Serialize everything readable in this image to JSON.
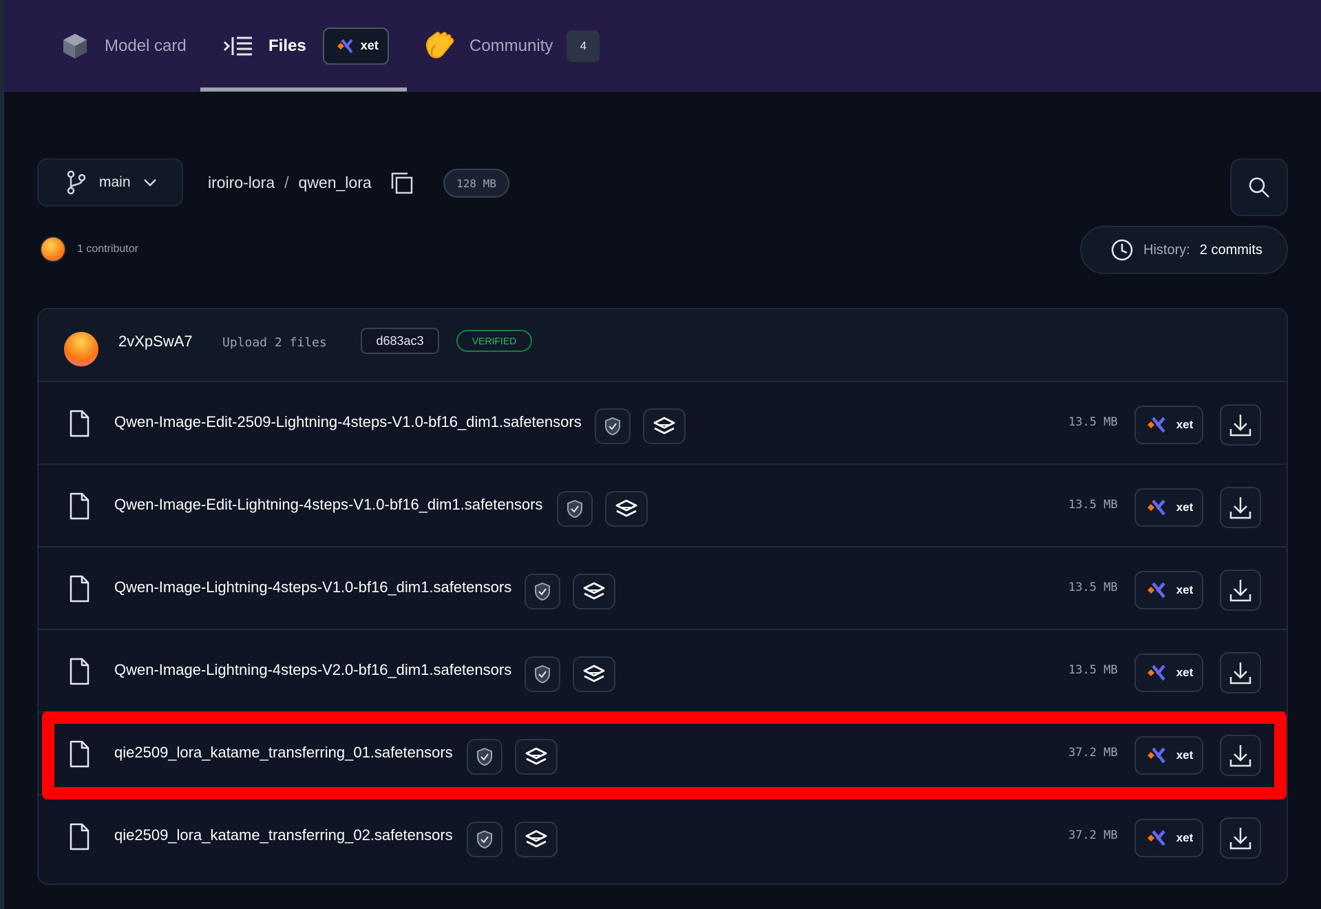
{
  "nav": {
    "tabs": [
      {
        "label": "Model card",
        "icon": "cube-icon"
      },
      {
        "label": "Files",
        "icon": "file-tree-icon",
        "badge": "xet"
      },
      {
        "label": "Community",
        "icon": "clapping-hands-icon",
        "count": "4"
      }
    ]
  },
  "repo": {
    "branch": "main",
    "owner": "iroiro-lora",
    "name": "qwen_lora",
    "size": "128 MB",
    "contributors": "1 contributor",
    "history_label": "History:",
    "history_value": "2 commits"
  },
  "commit": {
    "author": "2vXpSwA7",
    "message": "Upload 2 files",
    "sha": "d683ac3",
    "status": "VERIFIED"
  },
  "files": [
    {
      "name": "Qwen-Image-Edit-2509-Lightning-4steps-V1.0-bf16_dim1.safetensors",
      "size": "13.5 MB",
      "xet": "xet"
    },
    {
      "name": "Qwen-Image-Edit-Lightning-4steps-V1.0-bf16_dim1.safetensors",
      "size": "13.5 MB",
      "xet": "xet"
    },
    {
      "name": "Qwen-Image-Lightning-4steps-V1.0-bf16_dim1.safetensors",
      "size": "13.5 MB",
      "xet": "xet"
    },
    {
      "name": "Qwen-Image-Lightning-4steps-V2.0-bf16_dim1.safetensors",
      "size": "13.5 MB",
      "xet": "xet"
    },
    {
      "name": "qie2509_lora_katame_transferring_01.safetensors",
      "size": "37.2 MB",
      "xet": "xet"
    },
    {
      "name": "qie2509_lora_katame_transferring_02.safetensors",
      "size": "37.2 MB",
      "xet": "xet"
    }
  ],
  "colors": {
    "nav_bg": "#241b47",
    "page_bg": "#0b0f19",
    "verified": "#22c55e",
    "highlight": "#ff0000",
    "xet_orange": "#f97316",
    "xet_purple": "#6366f1"
  }
}
